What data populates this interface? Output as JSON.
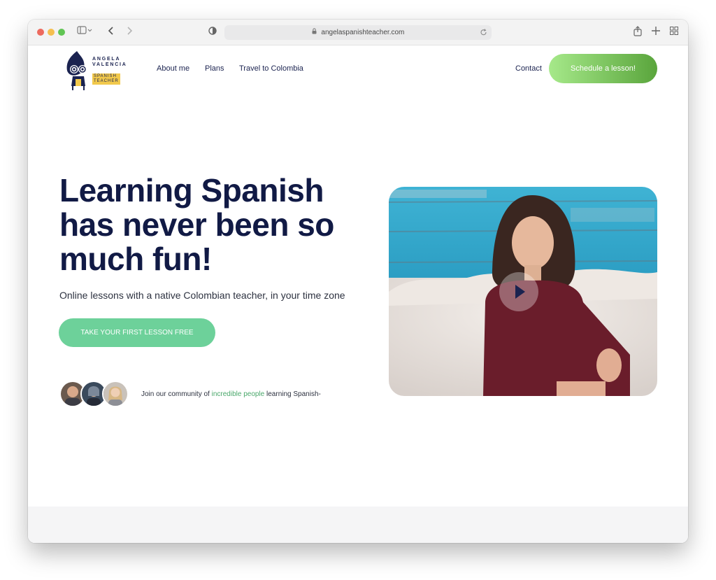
{
  "browser": {
    "url": "angelaspanishteacher.com"
  },
  "logo": {
    "line1": "ANGELA",
    "line2": "VALENCIA",
    "line3": "SPANISH",
    "line4": "TEACHER"
  },
  "nav": {
    "items": [
      {
        "label": "About me"
      },
      {
        "label": "Plans"
      },
      {
        "label": "Travel to Colombia"
      }
    ],
    "contact": "Contact",
    "cta": "Schedule a lesson!"
  },
  "hero": {
    "title_line1": "Learning Spanish",
    "title_line2": "has never been so",
    "title_line3": "much fun!",
    "subtitle": "Online lessons with a native Colombian teacher, in your time zone",
    "cta": "TAKE YOUR FIRST LESSON FREE",
    "community_before": "Join our community of ",
    "community_highlight": "incredible people",
    "community_after": " learning Spanish-"
  },
  "colors": {
    "brand_navy": "#111a45",
    "cta_green_start": "#a6e98a",
    "cta_green_end": "#5aa53c",
    "hero_cta": "#6dd19a",
    "highlight": "#4aa86b"
  }
}
